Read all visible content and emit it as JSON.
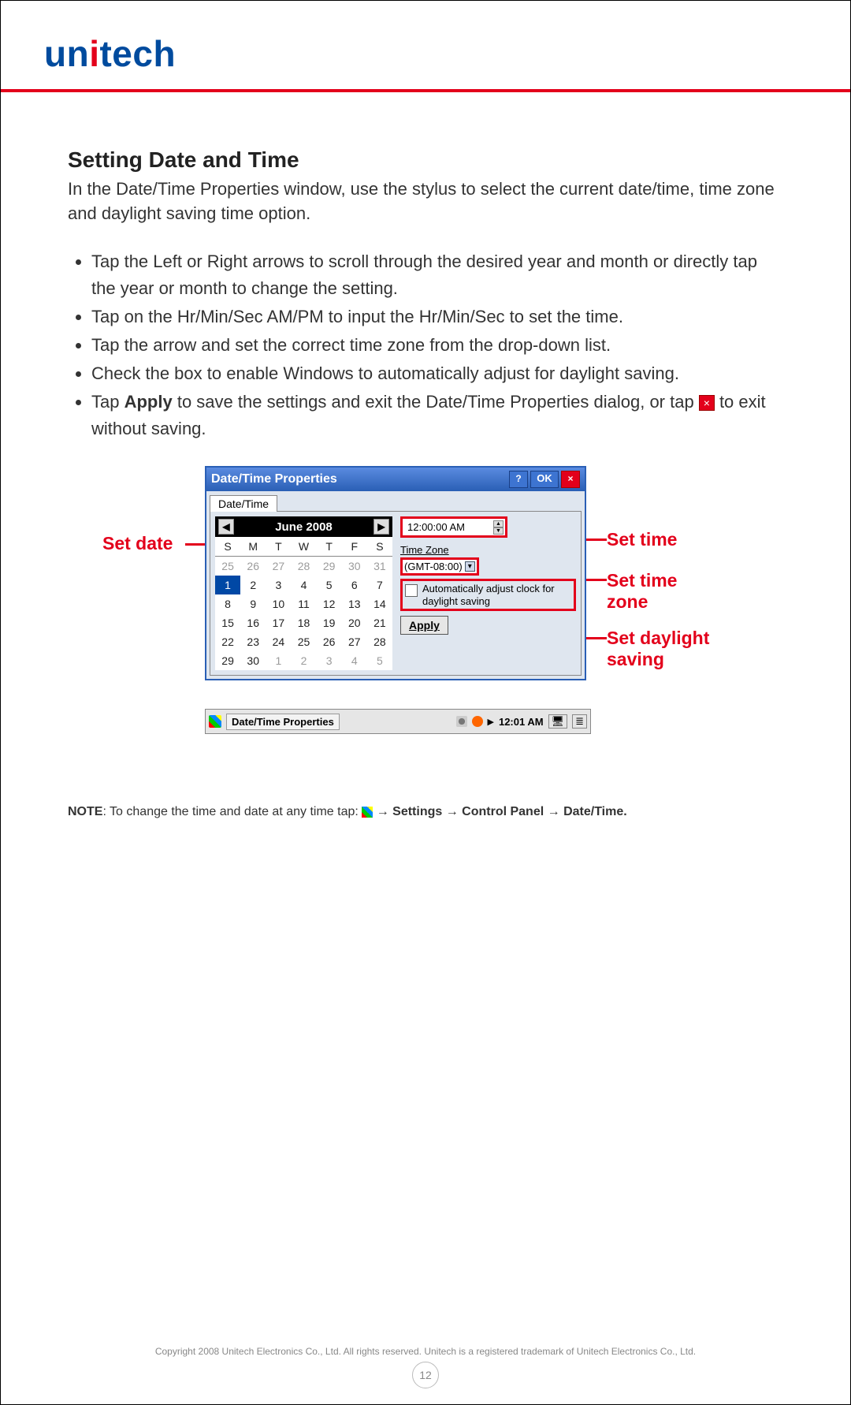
{
  "brand": {
    "name_pre": "un",
    "name_i": "i",
    "name_post": "tech"
  },
  "section_title": "Setting Date and Time",
  "intro": "In the Date/Time Properties window, use the stylus to select the current date/time, time zone and daylight saving time option.",
  "steps": {
    "s1": "Tap the Left or Right arrows to scroll through the desired year and month or directly tap the year or month to change the setting.",
    "s2": "Tap on the Hr/Min/Sec AM/PM to input the Hr/Min/Sec to set the time.",
    "s3": "Tap the arrow and set the correct time zone from the drop-down list.",
    "s4": "Check the box to enable Windows to automatically adjust for daylight saving.",
    "s5a": "Tap ",
    "s5b": "Apply",
    "s5c": " to save the settings and exit the Date/Time Properties dialog, or tap ",
    "s5d": " to exit without saving."
  },
  "callouts": {
    "set_date": "Set date",
    "set_time": "Set time",
    "set_tz": "Set time zone",
    "set_dst": "Set daylight saving"
  },
  "dialog": {
    "title": "Date/Time Properties",
    "help": "?",
    "ok": "OK",
    "x": "×",
    "tab": "Date/Time",
    "month": "June 2008",
    "arrow_l": "◀",
    "arrow_r": "▶",
    "days": {
      "d0": "S",
      "d1": "M",
      "d2": "T",
      "d3": "W",
      "d4": "T",
      "d5": "F",
      "d6": "S"
    },
    "cells": {
      "r0c0": "25",
      "r0c1": "26",
      "r0c2": "27",
      "r0c3": "28",
      "r0c4": "29",
      "r0c5": "30",
      "r0c6": "31",
      "r1c0": "1",
      "r1c1": "2",
      "r1c2": "3",
      "r1c3": "4",
      "r1c4": "5",
      "r1c5": "6",
      "r1c6": "7",
      "r2c0": "8",
      "r2c1": "9",
      "r2c2": "10",
      "r2c3": "11",
      "r2c4": "12",
      "r2c5": "13",
      "r2c6": "14",
      "r3c0": "15",
      "r3c1": "16",
      "r3c2": "17",
      "r3c3": "18",
      "r3c4": "19",
      "r3c5": "20",
      "r3c6": "21",
      "r4c0": "22",
      "r4c1": "23",
      "r4c2": "24",
      "r4c3": "25",
      "r4c4": "26",
      "r4c5": "27",
      "r4c6": "28",
      "r5c0": "29",
      "r5c1": "30",
      "r5c2": "1",
      "r5c3": "2",
      "r5c4": "3",
      "r5c5": "4",
      "r5c6": "5"
    },
    "time_value": "12:00:00 AM",
    "tz_label": "Time Zone",
    "tz_value": "(GMT-08:00)",
    "dst_text": "Automatically adjust clock for daylight saving",
    "apply": "Apply"
  },
  "taskbar": {
    "app": "Date/Time Properties",
    "clock": "12:01 AM"
  },
  "note": {
    "prefix": "NOTE",
    "text1": ": To change the time and date at any time tap: ",
    "text2": " → Settings → Control Panel → Date/Time."
  },
  "copyright": "Copyright 2008 Unitech Electronics Co., Ltd. All rights reserved. Unitech is a registered trademark of Unitech Electronics Co., Ltd.",
  "page_number": "12"
}
